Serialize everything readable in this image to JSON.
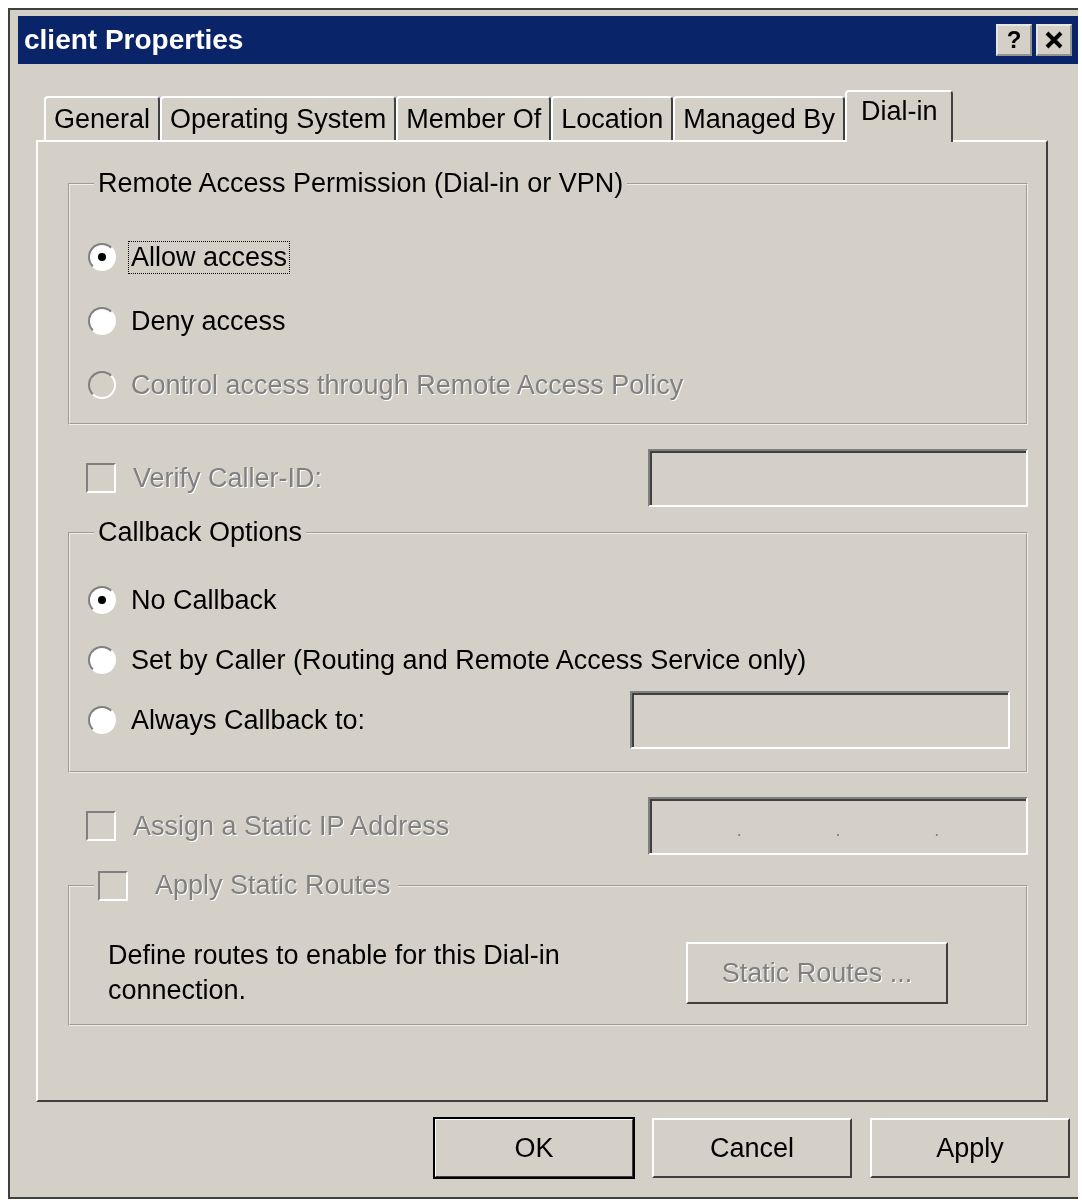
{
  "window": {
    "title": "client Properties",
    "help_button": "?"
  },
  "tabs": [
    {
      "label": "General",
      "selected": false
    },
    {
      "label": "Operating System",
      "selected": false
    },
    {
      "label": "Member Of",
      "selected": false
    },
    {
      "label": "Location",
      "selected": false
    },
    {
      "label": "Managed By",
      "selected": false
    },
    {
      "label": "Dial-in",
      "selected": true
    }
  ],
  "remote_access": {
    "title": "Remote Access Permission (Dial-in or VPN)",
    "options": [
      {
        "label": "Allow access",
        "selected": true,
        "disabled": false,
        "focused": true
      },
      {
        "label": "Deny access",
        "selected": false,
        "disabled": false,
        "focused": false
      },
      {
        "label": "Control access through Remote Access Policy",
        "selected": false,
        "disabled": true,
        "focused": false
      }
    ]
  },
  "verify_caller_id": {
    "label": "Verify Caller-ID:",
    "checked": false,
    "disabled": true
  },
  "callback": {
    "title": "Callback Options",
    "options": [
      {
        "label": "No Callback",
        "selected": true,
        "disabled": false,
        "has_field": false
      },
      {
        "label": "Set by Caller (Routing and Remote Access Service only)",
        "selected": false,
        "disabled": false,
        "has_field": false
      },
      {
        "label": "Always Callback to:",
        "selected": false,
        "disabled": false,
        "has_field": true
      }
    ]
  },
  "static_ip": {
    "label": "Assign a Static IP Address",
    "checked": false,
    "disabled": true,
    "separators": [
      ".",
      ".",
      "."
    ]
  },
  "static_routes": {
    "label": "Apply Static Routes",
    "checked": false,
    "disabled": true,
    "description": "Define routes to enable for this Dial-in connection.",
    "button": {
      "label": "Static Routes ...",
      "disabled": true
    }
  },
  "buttons": [
    {
      "label": "OK",
      "default": true
    },
    {
      "label": "Cancel",
      "default": false
    },
    {
      "label": "Apply",
      "default": false
    }
  ]
}
